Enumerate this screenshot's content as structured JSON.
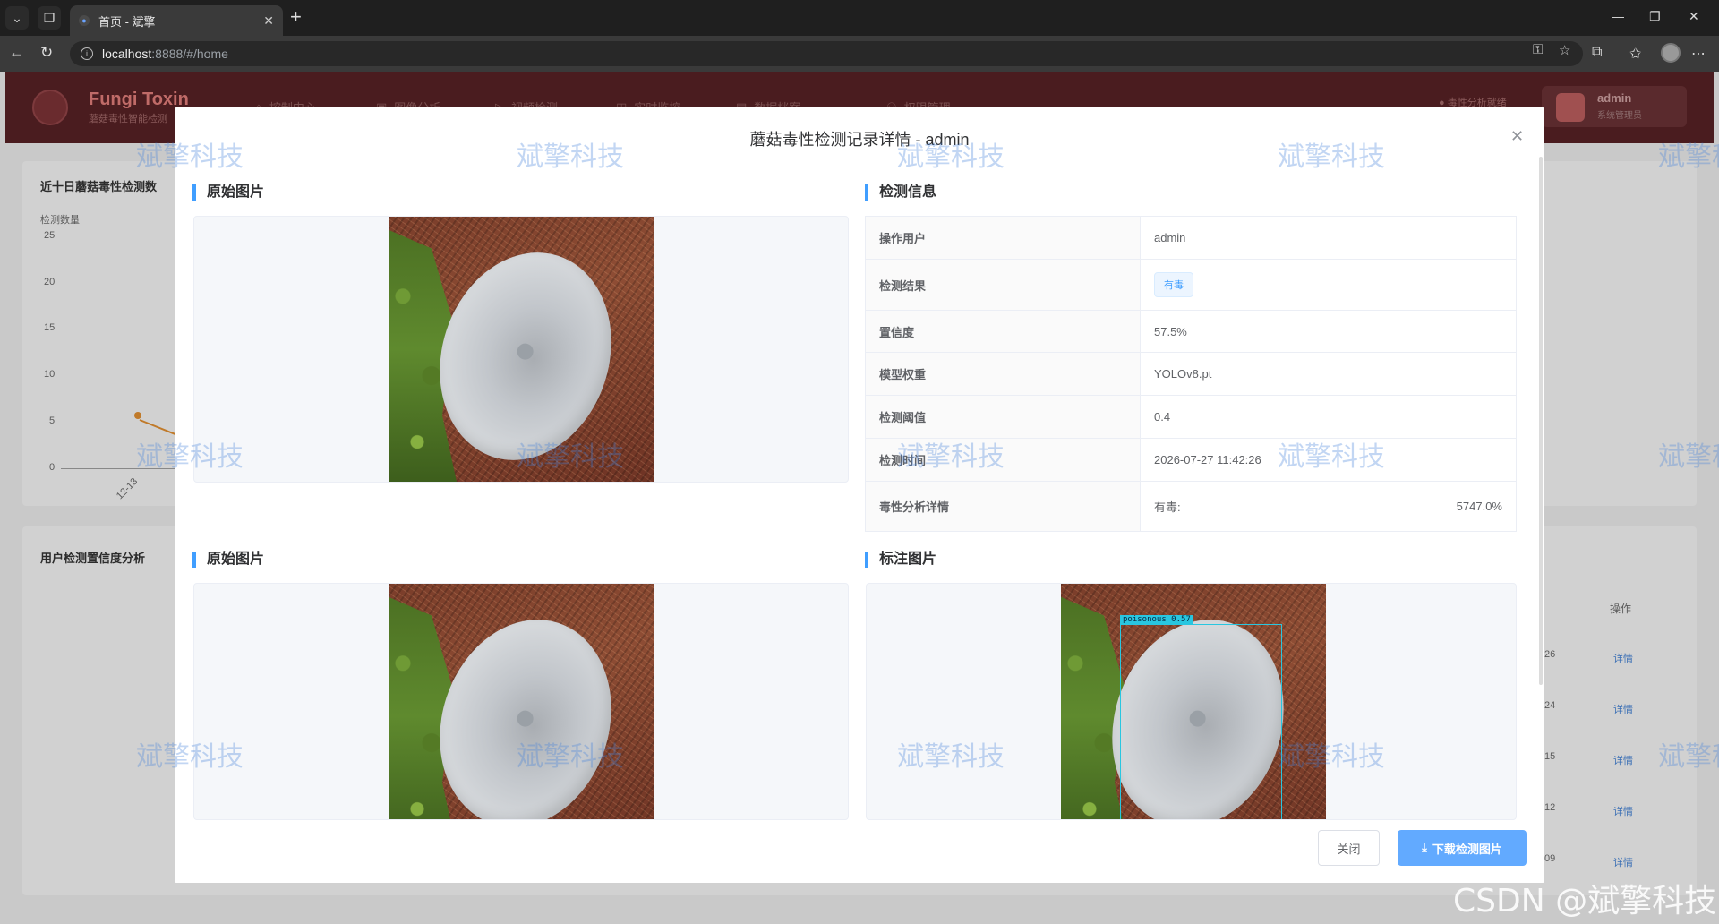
{
  "browser": {
    "tab_title": "首页 - 斌擎",
    "url_host": "localhost",
    "url_path": ":8888/#/home"
  },
  "app": {
    "brand": "Fungi Toxin",
    "brand_sub": "蘑菇毒性智能检测",
    "menu": [
      "控制中心",
      "图像分析",
      "视频检测",
      "实时监控",
      "数据档案",
      "权限管理"
    ],
    "status": "毒性分析就绪",
    "user_name": "admin",
    "user_role": "系统管理员",
    "chart_title": "近十日蘑菇毒性检测数",
    "chart_ylabel": "检测数量",
    "y_ticks": [
      "25",
      "20",
      "15",
      "10",
      "5",
      "0"
    ],
    "x_tick": "12-13",
    "card2_title": "用户检测置信度分析",
    "op_header": "操作",
    "row_vals": [
      "26",
      "24",
      "15",
      "12",
      "09"
    ],
    "detail_link": "详情"
  },
  "modal": {
    "title": "蘑菇毒性检测记录详情 - admin",
    "section_original": "原始图片",
    "section_info": "检测信息",
    "section_original_2": "原始图片",
    "section_annotated": "标注图片",
    "bbox_label": "poisonous 0.57",
    "info": [
      {
        "label": "操作用户",
        "value": "admin"
      },
      {
        "label": "检测结果",
        "value": "有毒"
      },
      {
        "label": "置信度",
        "value": "57.5%"
      },
      {
        "label": "模型权重",
        "value": "YOLOv8.pt"
      },
      {
        "label": "检测阈值",
        "value": "0.4"
      },
      {
        "label": "检测时间",
        "value": "2026-07-27 11:42:26"
      },
      {
        "label": "毒性分析详情",
        "value": "有毒:",
        "extra": "5747.0%"
      }
    ],
    "close_label": "关闭",
    "download_label": "下载检测图片"
  },
  "watermark": "斌擎科技",
  "footer_watermark": "CSDN @斌擎科技",
  "colors": {
    "accent": "#409eff",
    "header": "#4a1c1f",
    "bbox": "#29c6e0"
  }
}
